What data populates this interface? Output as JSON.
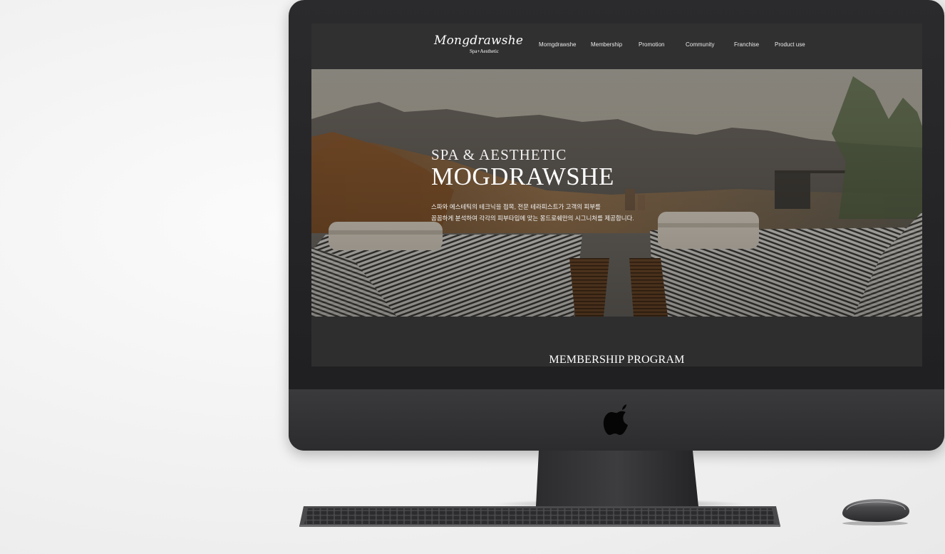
{
  "nav": {
    "logo": {
      "main": "Mongdrawshe",
      "sub": "Spa+Aesthetic"
    },
    "items": [
      "Momgdrawshe",
      "Membership",
      "Promotion",
      "Community",
      "Franchise",
      "Product use"
    ]
  },
  "hero": {
    "subtitle": "SPA  &  AESTHETIC",
    "title": "MOGDRAWSHE",
    "description": [
      "스파와 에스테틱의 테크닉을 접목, 전문 테라피스트가 고객의 피부를",
      "꼼꼼하게 분석하여 각각의 피부타입에 맞는 몽드로쉐만의 시그니처를 제공합니다."
    ]
  },
  "membership": {
    "title": "MEMBERSHIP PROGRAM"
  },
  "device": {
    "logo_icon": "apple-logo-icon"
  },
  "colors": {
    "navbar": "#303030",
    "section": "#2e2e2e",
    "text": "#ffffff"
  }
}
